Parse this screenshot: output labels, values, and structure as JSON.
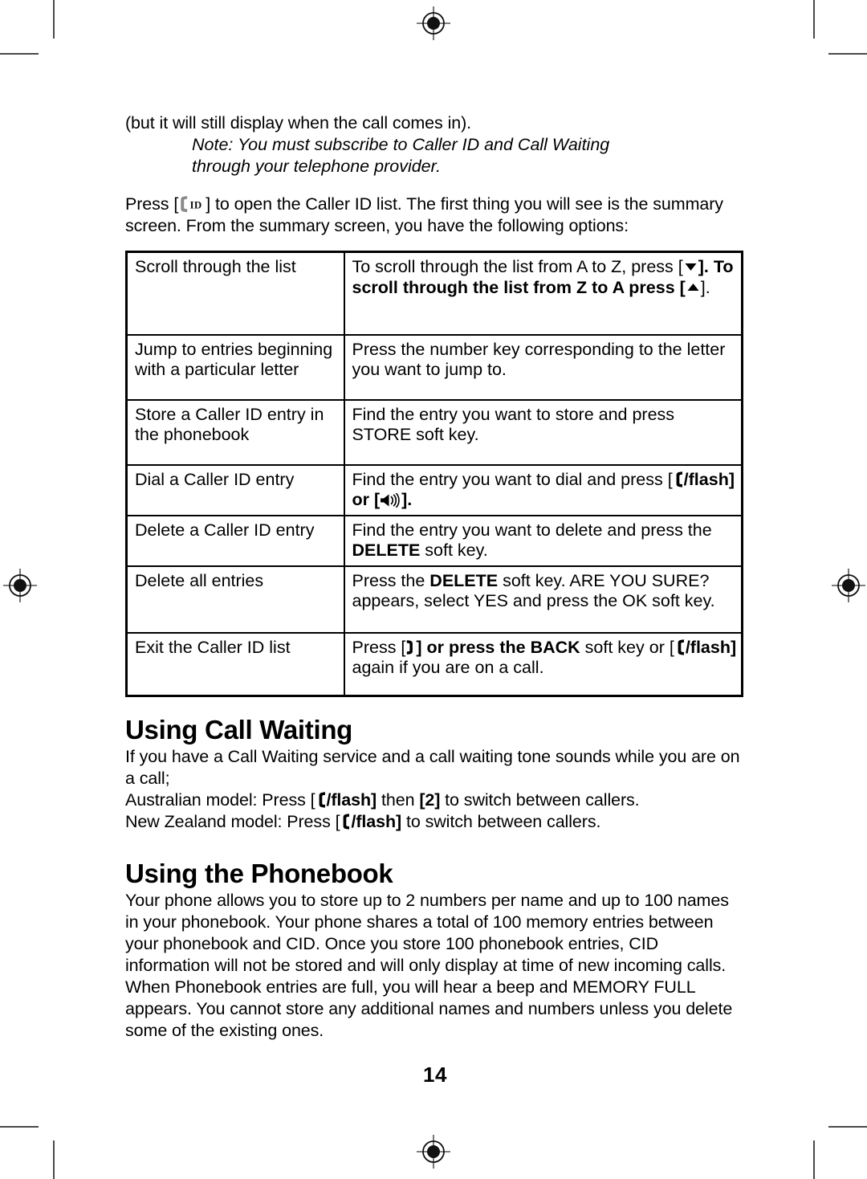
{
  "document": {
    "page_number": "14",
    "intro": {
      "line1": "(but it will still display when the call comes in).",
      "note_line1": "Note: You must subscribe to Caller ID and Call Waiting",
      "note_line2": "through your telephone provider.",
      "press_before": "Press [",
      "press_after": "] to open the Caller ID list. The first thing you will see is the summary screen. From the summary screen, you have the following options:"
    },
    "table": {
      "rows": [
        {
          "action": "Scroll through the list",
          "desc_1": "To scroll through the list from A to Z, press [",
          "desc_2": "]. To scroll through the list from Z to A press [",
          "desc_3": "]."
        },
        {
          "action": "Jump to entries beginning with a particular letter",
          "desc_1": "Press the number key corresponding to the letter you want to jump to."
        },
        {
          "action": "Store a Caller ID entry in the phonebook",
          "desc_1": "Find the entry you want to store and press STORE soft key."
        },
        {
          "action": "Dial a Caller ID entry",
          "desc_1": "Find the entry you want to dial and press [",
          "desc_2": "/flash] or [",
          "desc_3": "]."
        },
        {
          "action": "Delete a Caller ID entry",
          "desc_1": "Find the entry you want to delete and press the ",
          "desc_bold": "DELETE",
          "desc_2": " soft key."
        },
        {
          "action": "Delete all entries",
          "desc_1": "Press the ",
          "desc_bold": "DELETE",
          "desc_2": " soft key. ARE YOU SURE? appears, select YES and press the OK soft key."
        },
        {
          "action": "Exit the Caller ID list",
          "desc_1": "Press [",
          "desc_2": "] or press the ",
          "desc_bold": "BACK",
          "desc_3": " soft key or [",
          "desc_4": "/flash]",
          "desc_5": " again if you are on a call."
        }
      ]
    },
    "call_waiting": {
      "heading": "Using Call Waiting",
      "body_1": "If you have a Call Waiting service and a call waiting tone sounds while you are on a call;",
      "au_prefix": "Australian model: Press [",
      "au_flash": "/flash]",
      "au_mid": " then ",
      "au_key": "[2]",
      "au_suffix": " to switch between callers.",
      "nz_prefix": "New Zealand model: Press [",
      "nz_flash": "/flash]",
      "nz_suffix": " to switch between callers."
    },
    "phonebook": {
      "heading": "Using the Phonebook",
      "body": "Your phone allows you to store up to 2 numbers per name and up to 100 names in your phonebook. Your phone shares a total of 100 memory entries between your phonebook and CID. Once you store 100 phonebook entries, CID information will not be stored and will only display at time of new incoming calls. When Phonebook entries are full, you will hear a beep and MEMORY FULL appears. You cannot store any additional names and numbers unless you delete some of the existing ones."
    },
    "icons": {
      "caller_id": "caller-id-handset-icon",
      "flash": "flash-handset-icon",
      "speaker": "speakerphone-icon",
      "end_call": "end-call-handset-icon",
      "arrow_down": "arrow-down-icon",
      "arrow_up": "arrow-up-icon"
    },
    "print_marks": {
      "registration": "registration-target"
    }
  }
}
